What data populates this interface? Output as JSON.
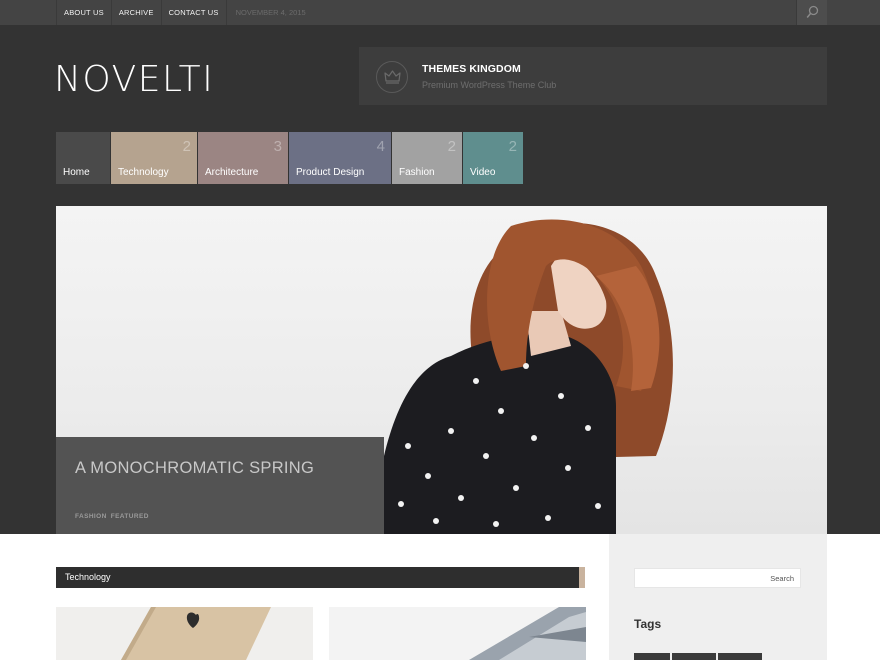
{
  "topbar": {
    "links": [
      "ABOUT US",
      "ARCHIVE",
      "CONTACT US"
    ],
    "date": "NOVEMBER 4, 2015",
    "search_icon": "search-icon"
  },
  "header": {
    "logo": "NOVELTI",
    "promo": {
      "title": "THEMES KINGDOM",
      "subtitle": "Premium WordPress Theme Club",
      "icon": "crown-emblem-icon"
    }
  },
  "menu": {
    "items": [
      {
        "label": "Home",
        "count": "",
        "color": "#4a4a4a"
      },
      {
        "label": "Technology",
        "count": "2",
        "color": "#b5a38f"
      },
      {
        "label": "Architecture",
        "count": "3",
        "color": "#9b8583"
      },
      {
        "label": "Product Design",
        "count": "4",
        "color": "#6c7085"
      },
      {
        "label": "Fashion",
        "count": "2",
        "color": "#a2a2a2"
      },
      {
        "label": "Video",
        "count": "2",
        "color": "#5f8e8e"
      }
    ]
  },
  "hero": {
    "title": "A MONOCHROMATIC SPRING",
    "tags": [
      "FASHION",
      "FEATURED"
    ]
  },
  "content": {
    "section_title": "Technology",
    "accent_color": "#c9b39e"
  },
  "sidebar": {
    "search_button": "Search",
    "tags_title": "Tags"
  }
}
